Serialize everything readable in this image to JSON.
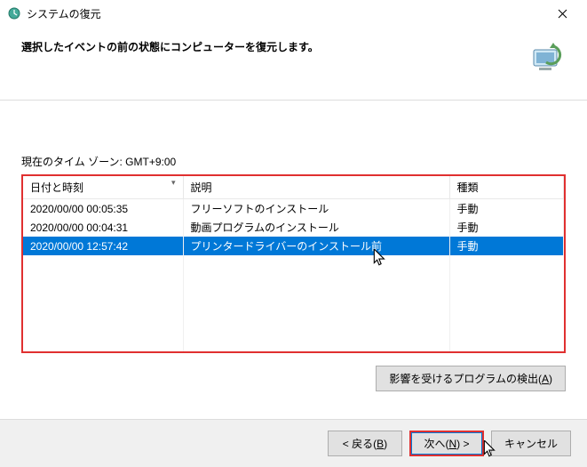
{
  "window": {
    "title": "システムの復元"
  },
  "header": {
    "text": "選択したイベントの前の状態にコンピューターを復元します。"
  },
  "timezone": {
    "label": "現在のタイム ゾーン: GMT+9:00"
  },
  "columns": {
    "datetime": "日付と時刻",
    "description": "説明",
    "type": "種類"
  },
  "rows": [
    {
      "datetime": "2020/00/00 00:05:35",
      "description": "フリーソフトのインストール",
      "type": "手動",
      "selected": false
    },
    {
      "datetime": "2020/00/00 00:04:31",
      "description": "動画プログラムのインストール",
      "type": "手動",
      "selected": false
    },
    {
      "datetime": "2020/00/00 12:57:42",
      "description": "プリンタードライバーのインストール前",
      "type": "手動",
      "selected": true
    }
  ],
  "buttons": {
    "scan": "影響を受けるプログラムの検出(A)",
    "back": "< 戻る(B)",
    "next": "次へ(N) >",
    "cancel": "キャンセル"
  },
  "accel": {
    "scan": "A",
    "back": "B",
    "next": "N"
  }
}
